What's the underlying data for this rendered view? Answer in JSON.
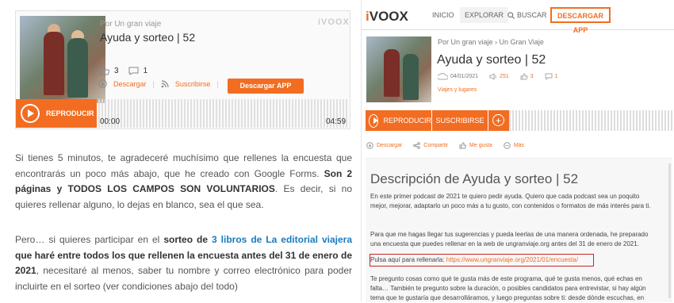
{
  "left": {
    "widget": {
      "author": "Por Un gran viaje",
      "title": "Ayuda y sorteo | 52",
      "logo": "iVOOX",
      "likes": "3",
      "comments": "1",
      "download": "Descargar",
      "subscribe": "Suscribirse",
      "app_button": "Descargar APP",
      "play": "REPRODUCIR",
      "time_start": "00:00",
      "time_end": "04:59"
    },
    "article": {
      "p1_a": "Si tienes 5 minutos, te agradeceré muchísimo que rellenes la encuesta que encontrarás un poco más abajo, que he creado con Google Forms. ",
      "p1_b": "Son 2 páginas y TODOS LOS CAMPOS SON VOLUNTARIOS",
      "p1_c": ". Es decir, si no quieres rellenar alguno, lo dejas en blanco, sea el que sea.",
      "p2_a": "Pero… si quieres participar en el ",
      "p2_b": "sorteo de ",
      "p2_link": "3 libros de La editorial viajera",
      "p2_c": " que haré entre todos los que rellenen la encuesta antes del 31 de enero de 2021",
      "p2_d": ", necesitaré al menos, saber tu nombre y correo electrónico para poder incluirte en el sorteo (ver condiciones abajo del todo)"
    }
  },
  "right": {
    "nav": {
      "logo": "iVOOX",
      "inicio": "INICIO",
      "explorar": "EXPLORAR",
      "buscar": "BUSCAR",
      "descargar_app": "DESCARGAR APP"
    },
    "episode": {
      "breadcrumb": "Por Un gran viaje  ›  Un Gran Viaje",
      "title": "Ayuda y sorteo | 52",
      "date": "04/01/2021",
      "plays": "251",
      "likes": "3",
      "comments": "1",
      "category": "Viajes y lugares"
    },
    "player": {
      "play": "REPRODUCIR",
      "subscribe": "SUSCRIBIRSE"
    },
    "actions": {
      "download": "Descargar",
      "share": "Compartir",
      "like": "Me gusta",
      "more": "Más"
    },
    "description": {
      "heading": "Descripción de Ayuda y sorteo | 52",
      "p1": "En este primer podcast de 2021 te quiero pedir ayuda. Quiero que cada podcast sea un poquito mejor, mejorar, adaptarlo un poco más a tu gusto, con contenidos o formatos de más interés para ti.",
      "p2": "Para que me hagas llegar tus sugerencias y pueda leerlas de una manera ordenada, he preparado una encuesta que puedes rellenar en la web de ungranviaje.org antes del 31 de enero de 2021.",
      "p3_label": "Pulsa aquí para rellenarla: ",
      "p3_link": "https://www.ungranviaje.org/2021/01/encuesta/",
      "p4": "Te pregunto cosas como qué te gusta más de este programa, qué te gusta menos, qué echas en falta… También te pregunto sobre la duración, o posibles candidatos para entrevistar, si hay algún tema que te gustaría que desarrolláramos, y luego preguntas sobre ti: desde dónde escuchas, en"
    }
  },
  "colors": {
    "accent": "#f26d21",
    "highlight_box": "#c62828",
    "link_blue": "#1a7bbf"
  }
}
